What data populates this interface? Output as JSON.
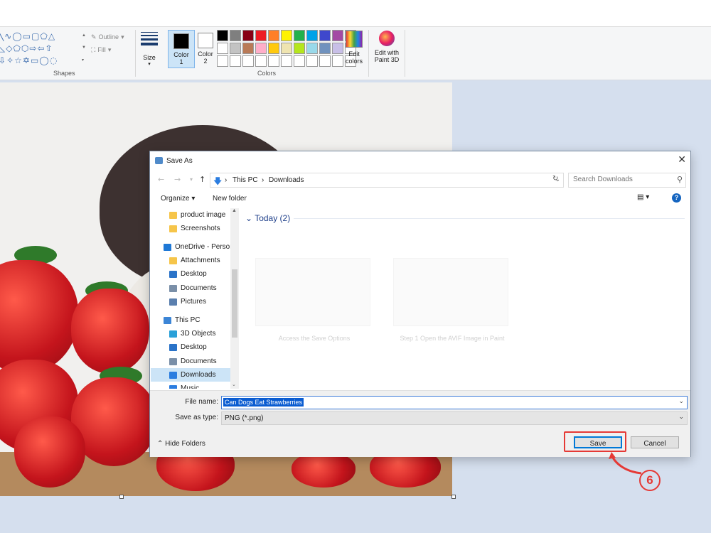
{
  "ribbon": {
    "outline_label": "Outline",
    "fill_label": "Fill",
    "shapes_group_label": "Shapes",
    "size_label": "Size",
    "color1_label_line1": "Color",
    "color1_label_line2": "1",
    "color2_label_line1": "Color",
    "color2_label_line2": "2",
    "colors_group_label": "Colors",
    "edit_colors_line1": "Edit",
    "edit_colors_line2": "colors",
    "paint3d_line1": "Edit with",
    "paint3d_line2": "Paint 3D",
    "palette_row1": [
      "#000000",
      "#7f7f7f",
      "#880015",
      "#ed1c24",
      "#ff7f27",
      "#fff200",
      "#22b14c",
      "#00a2e8",
      "#3f48cc",
      "#a349a4"
    ],
    "palette_row2": [
      "#ffffff",
      "#c3c3c3",
      "#b97a57",
      "#ffaec9",
      "#ffc90e",
      "#efe4b0",
      "#b5e61d",
      "#99d9ea",
      "#7092be",
      "#c8bfe7"
    ],
    "color1_value": "#000000",
    "color2_value": "#ffffff"
  },
  "dialog": {
    "title": "Save As",
    "close_glyph": "✕",
    "breadcrumb": [
      "This PC",
      "Downloads"
    ],
    "search_placeholder": "Search Downloads",
    "organize_label": "Organize ▾",
    "new_folder_label": "New folder",
    "nav_items": [
      {
        "label": "product image",
        "icon": "folder-icon",
        "color": "#f6c54a"
      },
      {
        "label": "Screenshots",
        "icon": "folder-icon",
        "color": "#f6c54a"
      },
      {
        "label": "OneDrive - Person",
        "icon": "cloud-icon",
        "color": "#1e78d6"
      },
      {
        "label": "Attachments",
        "icon": "folder-icon",
        "color": "#f6c54a"
      },
      {
        "label": "Desktop",
        "icon": "desktop-icon",
        "color": "#2a73c8"
      },
      {
        "label": "Documents",
        "icon": "documents-icon",
        "color": "#7a8fa8"
      },
      {
        "label": "Pictures",
        "icon": "pictures-icon",
        "color": "#5a7fae"
      },
      {
        "label": "This PC",
        "icon": "computer-icon",
        "color": "#3c85d6"
      },
      {
        "label": "3D Objects",
        "icon": "cube-icon",
        "color": "#2aa0d8"
      },
      {
        "label": "Desktop",
        "icon": "desktop-icon",
        "color": "#2a73c8"
      },
      {
        "label": "Documents",
        "icon": "documents-icon",
        "color": "#7a8fa8"
      },
      {
        "label": "Downloads",
        "icon": "download-icon",
        "color": "#2b7de0"
      },
      {
        "label": "Music",
        "icon": "music-icon",
        "color": "#2b7de0"
      }
    ],
    "selected_nav": "Downloads",
    "group_header": "Today (2)",
    "files": [
      {
        "name": "Access the Save Options"
      },
      {
        "name": "Step 1 Open the AVIF Image in Paint"
      }
    ],
    "file_name_label": "File name:",
    "file_name_value": "Can Dogs Eat Strawberries",
    "save_type_label": "Save as type:",
    "save_type_value": "PNG (*.png)",
    "hide_folders_label": "Hide Folders",
    "save_button": "Save",
    "cancel_button": "Cancel"
  },
  "annotation": {
    "step_number": "6",
    "color": "#e53935"
  }
}
